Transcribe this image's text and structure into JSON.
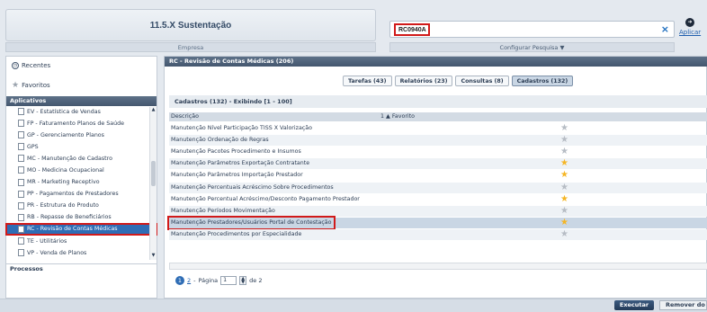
{
  "header": {
    "environment_title": "11.5.X Sustentação",
    "environment_caption": "Empresa",
    "search_value": "RC0940A",
    "search_clear": "×",
    "search_caption": "Configurar Pesquisa ▼",
    "apply_label": "Aplicar"
  },
  "sidebar": {
    "recent_label": "Recentes",
    "favorites_label": "Favoritos",
    "apps_header": "Aplicativos",
    "apps": [
      {
        "label": "EV - Estatística de Vendas"
      },
      {
        "label": "FP - Faturamento Planos de Saúde"
      },
      {
        "label": "GP - Gerenciamento Planos"
      },
      {
        "label": "GPS"
      },
      {
        "label": "MC - Manutenção de Cadastro"
      },
      {
        "label": "MO - Medicina Ocupacional"
      },
      {
        "label": "MR - Marketing Receptivo"
      },
      {
        "label": "PP - Pagamentos de Prestadores"
      },
      {
        "label": "PR - Estrutura do Produto"
      },
      {
        "label": "RB - Repasse de Beneficiários"
      },
      {
        "label": "RC - Revisão de Contas Médicas",
        "selected": true
      },
      {
        "label": "TE - Utilitários"
      },
      {
        "label": "VP - Venda de Planos"
      }
    ],
    "processes_header": "Processos"
  },
  "main": {
    "title": "RC - Revisão de Contas Médicas (206)",
    "tabs": [
      {
        "label": "Tarefas (43)"
      },
      {
        "label": "Relatórios (23)"
      },
      {
        "label": "Consultas (8)"
      },
      {
        "label": "Cadastros (132)",
        "active": true
      }
    ],
    "list_header": "Cadastros (132) - Exibindo [1 - 100]",
    "columns": {
      "description": "Descrição",
      "favorite": "1 ▲ Favorito"
    },
    "rows": [
      {
        "description": "Manutenção Nível Participação TISS X Valorização",
        "favorite": false
      },
      {
        "description": "Manutenção Ordenação de Regras",
        "favorite": false
      },
      {
        "description": "Manutenção Pacotes Procedimento e Insumos",
        "favorite": false
      },
      {
        "description": "Manutenção Parâmetros Exportação Contratante",
        "favorite": true
      },
      {
        "description": "Manutenção Parâmetros Importação Prestador",
        "favorite": true
      },
      {
        "description": "Manutenção Percentuais Acréscimo Sobre Procedimentos",
        "favorite": false
      },
      {
        "description": "Manutenção Percentual Acréscimo/Desconto Pagamento Prestador",
        "favorite": true
      },
      {
        "description": "Manutenção Períodos Movimentação",
        "favorite": false
      },
      {
        "description": "Manutenção Prestadores/Usuários Portal de Contestação",
        "favorite": true,
        "selected": true
      },
      {
        "description": "Manutenção Procedimentos por Especialidade",
        "favorite": false
      }
    ],
    "pager": {
      "current": "1",
      "next": "2",
      "separator": "-",
      "page_label": "Página",
      "page_value": "1",
      "of_label": "de 2"
    }
  },
  "footer": {
    "execute_label": "Executar",
    "remove_label": "Remover do"
  }
}
